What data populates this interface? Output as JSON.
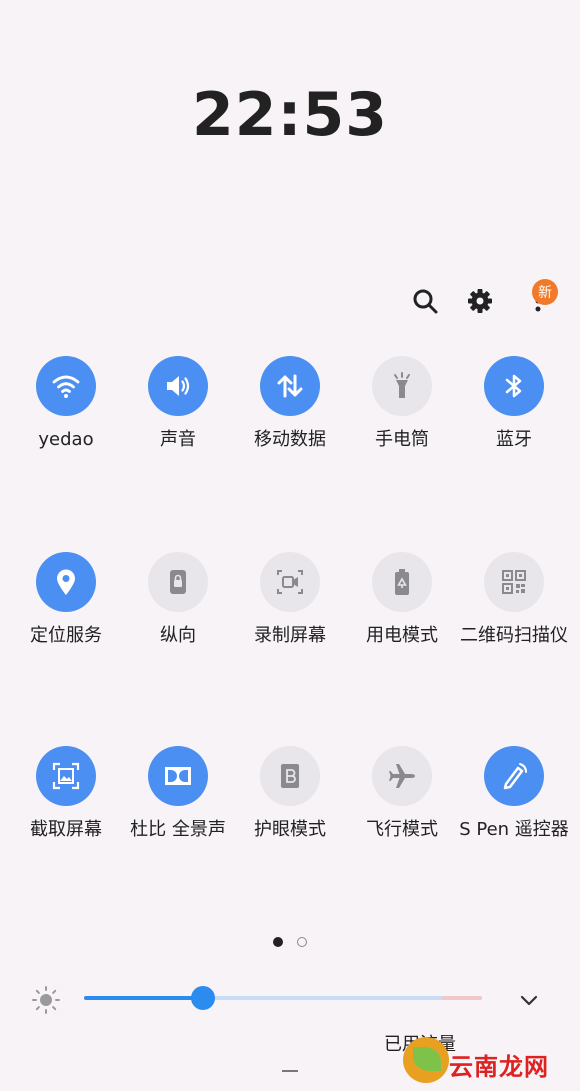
{
  "status": {
    "time": "22:53"
  },
  "header": {
    "new_badge": "新"
  },
  "tiles": [
    {
      "label": "yedao",
      "icon": "wifi-icon",
      "active": true
    },
    {
      "label": "声音",
      "icon": "sound-icon",
      "active": true
    },
    {
      "label": "移动数据",
      "icon": "mobile-data-icon",
      "active": true
    },
    {
      "label": "手电筒",
      "icon": "flashlight-icon",
      "active": false
    },
    {
      "label": "蓝牙",
      "icon": "bluetooth-icon",
      "active": true
    },
    {
      "label": "定位服务",
      "icon": "location-icon",
      "active": true
    },
    {
      "label": "纵向",
      "icon": "portrait-lock-icon",
      "active": false
    },
    {
      "label": "录制屏幕",
      "icon": "screen-record-icon",
      "active": false
    },
    {
      "label": "用电模式",
      "icon": "power-mode-icon",
      "active": false
    },
    {
      "label": "二维码扫描仪",
      "icon": "qr-scanner-icon",
      "active": false
    },
    {
      "label": "截取屏幕",
      "icon": "screenshot-icon",
      "active": true
    },
    {
      "label": "杜比 全景声",
      "icon": "dolby-atmos-icon",
      "active": true
    },
    {
      "label": "护眼模式",
      "icon": "eye-comfort-icon",
      "active": false
    },
    {
      "label": "飞行模式",
      "icon": "airplane-icon",
      "active": false
    },
    {
      "label": "S Pen 遥控器",
      "icon": "s-pen-icon",
      "active": true
    }
  ],
  "pager": {
    "pages": 2,
    "current": 1
  },
  "brightness": {
    "level": 0.3
  },
  "usage_label": "已用流量",
  "watermark": "云南龙网",
  "colors": {
    "accent": "#4c8ff2",
    "inactive": "#e8e6ea",
    "badge": "#f07a2a",
    "slider": "#2b8bef"
  }
}
